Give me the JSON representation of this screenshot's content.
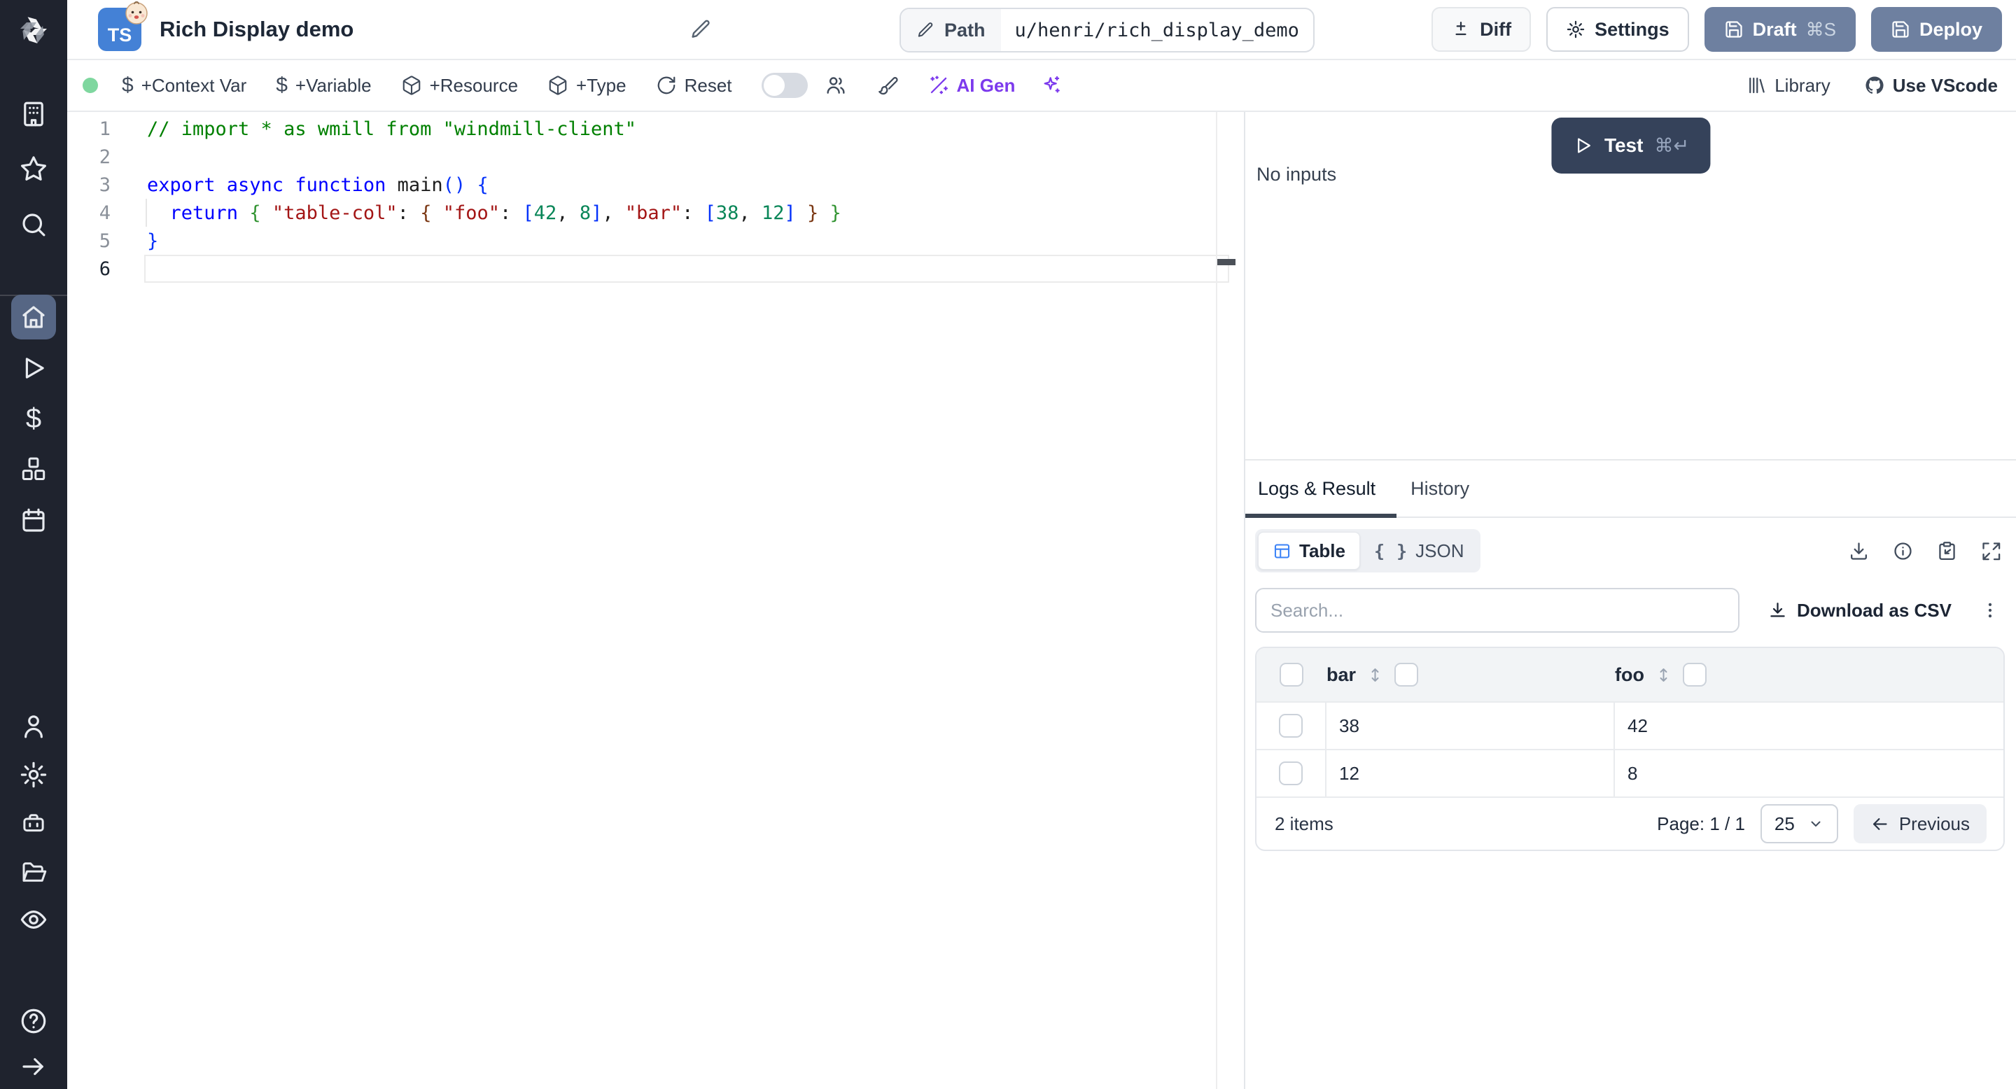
{
  "header": {
    "language_badge": "TS",
    "title": "Rich Display demo",
    "path_label": "Path",
    "path_value": "u/henri/rich_display_demo",
    "diff_label": "Diff",
    "settings_label": "Settings",
    "draft_label": "Draft",
    "draft_shortcut": "⌘S",
    "deploy_label": "Deploy"
  },
  "toolbar": {
    "context_var": "+Context Var",
    "variable": "+Variable",
    "resource": "+Resource",
    "type": "+Type",
    "reset": "Reset",
    "ai_gen": "AI Gen",
    "library": "Library",
    "use_vscode": "Use VScode",
    "dollar_glyph": "$"
  },
  "sidebar": {
    "active_item": "home",
    "icons": [
      "windmill-logo",
      "building",
      "star",
      "search",
      "home",
      "play",
      "dollar",
      "boxes",
      "calendar",
      "user",
      "settings",
      "robot",
      "folder-open",
      "eye",
      "help",
      "arrow-right"
    ],
    "dollar_glyph": "$"
  },
  "editor": {
    "lines": [
      {
        "num": "1",
        "tokens": [
          [
            "// import * as wmill from \"windmill-client\"",
            "cmt"
          ]
        ]
      },
      {
        "num": "2",
        "tokens": []
      },
      {
        "num": "3",
        "tokens": [
          [
            "export async function ",
            "kw"
          ],
          [
            "main",
            "fn"
          ],
          [
            "(",
            "b1"
          ],
          [
            ")",
            "b1"
          ],
          [
            " ",
            "pl"
          ],
          [
            "{",
            "b1"
          ]
        ]
      },
      {
        "num": "4",
        "tokens": [
          [
            "  ",
            "pl"
          ],
          [
            "return",
            "kw"
          ],
          [
            " ",
            "pl"
          ],
          [
            "{",
            "b2"
          ],
          [
            " ",
            "pl"
          ],
          [
            "\"table-col\"",
            "str"
          ],
          [
            ": ",
            "pl"
          ],
          [
            "{",
            "b3"
          ],
          [
            " ",
            "pl"
          ],
          [
            "\"foo\"",
            "str"
          ],
          [
            ": ",
            "pl"
          ],
          [
            "[",
            "b1"
          ],
          [
            "42",
            "num"
          ],
          [
            ", ",
            "pl"
          ],
          [
            "8",
            "num"
          ],
          [
            "]",
            "b1"
          ],
          [
            ", ",
            "pl"
          ],
          [
            "\"bar\"",
            "str"
          ],
          [
            ": ",
            "pl"
          ],
          [
            "[",
            "b1"
          ],
          [
            "38",
            "num"
          ],
          [
            ", ",
            "pl"
          ],
          [
            "12",
            "num"
          ],
          [
            "]",
            "b1"
          ],
          [
            " ",
            "pl"
          ],
          [
            "}",
            "b3"
          ],
          [
            " ",
            "pl"
          ],
          [
            "}",
            "b2"
          ]
        ]
      },
      {
        "num": "5",
        "tokens": [
          [
            "}",
            "b1"
          ]
        ]
      },
      {
        "num": "6",
        "tokens": [],
        "current": true
      }
    ]
  },
  "run_panel": {
    "test_label": "Test",
    "test_shortcut": "⌘↵",
    "no_inputs": "No inputs"
  },
  "result_panel": {
    "tabs": [
      {
        "label": "Logs & Result",
        "active": true
      },
      {
        "label": "History",
        "active": false
      }
    ],
    "view_toggle": {
      "table_label": "Table",
      "json_label": "JSON",
      "json_icon": "{ }"
    },
    "search_placeholder": "Search...",
    "download_csv_label": "Download as CSV",
    "table": {
      "columns": [
        "bar",
        "foo"
      ],
      "rows": [
        [
          "38",
          "42"
        ],
        [
          "12",
          "8"
        ]
      ]
    },
    "footer": {
      "items_text": "2 items",
      "page_text": "Page: 1 / 1",
      "page_size": "25",
      "previous_label": "Previous"
    }
  },
  "colors": {
    "rail_bg": "#1f232e",
    "rail_active": "#566684",
    "slate_button": "#6e80a0",
    "test_button": "#35425a",
    "ai_purple": "#7c3aed",
    "status_green": "#7fd79f",
    "ts_blue": "#4481d6",
    "table_icon_blue": "#3b82f6",
    "code_palette": {
      "comment": "#008000",
      "keyword": "#0000ff",
      "string": "#a31515",
      "number": "#098658",
      "bracket1": "#0431fa",
      "bracket2": "#319331",
      "bracket3": "#7b3814"
    }
  }
}
